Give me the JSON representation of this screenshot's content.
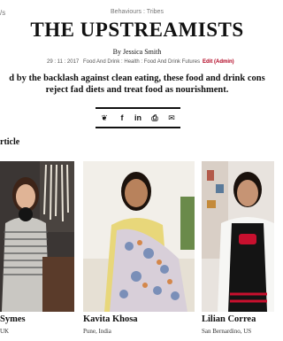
{
  "header": {
    "left_fragment": "/s",
    "breadcrumb": [
      "Behaviours",
      "Tribes"
    ],
    "breadcrumb_separator": " : ",
    "title": "THE UPSTREAMISTS",
    "byline": "By Jessica Smith",
    "date": "29 : 11 : 2017",
    "categories": "Food And Drink : Health : Food And Drink Futures",
    "edit_label": "Edit (Admin)"
  },
  "standfirst": {
    "line1": "d by the backlash against clean eating, these food and drink cons",
    "line2": "reject fad diets and treat food as nourishment."
  },
  "share": {
    "icons": [
      "twitter-icon",
      "facebook-icon",
      "linkedin-icon",
      "print-icon",
      "email-icon"
    ],
    "glyphs": [
      "❦",
      "f",
      "in",
      "⎙",
      "✉"
    ]
  },
  "section": {
    "title": "rticle"
  },
  "people": [
    {
      "name": "Symes",
      "location": "UK"
    },
    {
      "name": "Kavita Khosa",
      "location": "Pune, India"
    },
    {
      "name": "Lilian Correa",
      "location": "San Bernardino, US"
    }
  ],
  "colors": {
    "edit_red": "#b0001e",
    "apron_red": "#c8102e",
    "text": "#111111"
  }
}
